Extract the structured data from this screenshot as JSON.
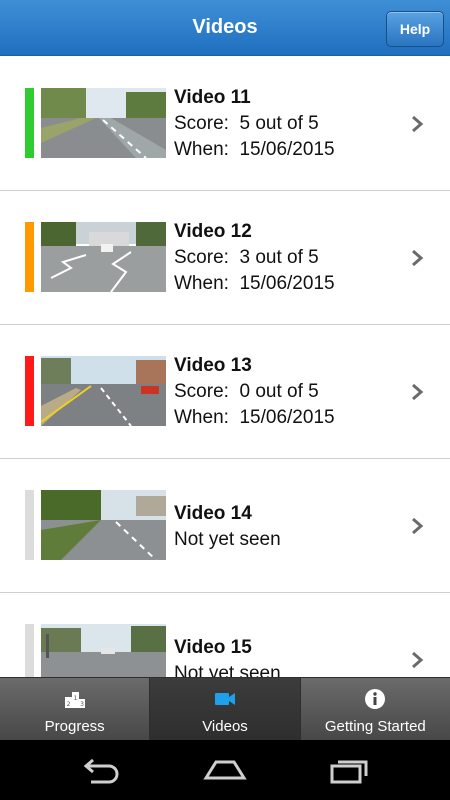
{
  "header": {
    "title": "Videos",
    "help_label": "Help"
  },
  "videos": [
    {
      "title": "Video 11",
      "score_label": "Score:",
      "score": "5 out of 5",
      "when_label": "When:",
      "when": "15/06/2015",
      "status_color": "#2ecc2e"
    },
    {
      "title": "Video 12",
      "score_label": "Score:",
      "score": "3 out of 5",
      "when_label": "When:",
      "when": "15/06/2015",
      "status_color": "#ff9900"
    },
    {
      "title": "Video 13",
      "score_label": "Score:",
      "score": "0 out of 5",
      "when_label": "When:",
      "when": "15/06/2015",
      "status_color": "#ff1a1a"
    },
    {
      "title": "Video 14",
      "status_text": "Not yet seen",
      "status_color": "#dcdcdc"
    },
    {
      "title": "Video 15",
      "status_text": "Not yet seen",
      "status_color": "#dcdcdc"
    }
  ],
  "tabs": [
    {
      "label": "Progress",
      "icon": "podium-icon"
    },
    {
      "label": "Videos",
      "icon": "video-camera-icon",
      "active": true
    },
    {
      "label": "Getting Started",
      "icon": "info-icon"
    }
  ],
  "colors": {
    "header": "#2a7bcb",
    "active_tab_icon": "#1fa0ea"
  }
}
